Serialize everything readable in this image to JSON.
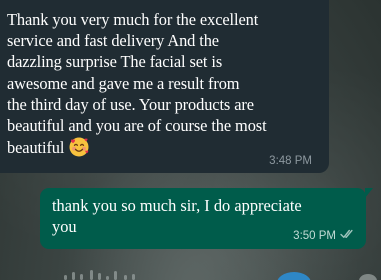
{
  "incoming_message": {
    "text": "Thank you very much for the excellent\nservice and fast delivery And the\ndazzling surprise The facial set is\nawesome and gave me a result from\nthe third day of use. Your products are\nbeautiful and you are of course the most\nbeautiful",
    "emoji": "smiling-face-with-hearts",
    "time": "3:48 PM"
  },
  "outgoing_message": {
    "text": "thank you so much sir, I do appreciate\nyou",
    "time": "3:50 PM",
    "status": "read"
  },
  "colors": {
    "incoming_bubble": "#202c33",
    "outgoing_bubble": "#005c4b",
    "read_ticks": "#9fc4bc",
    "voice_play": "#2e87c6"
  }
}
